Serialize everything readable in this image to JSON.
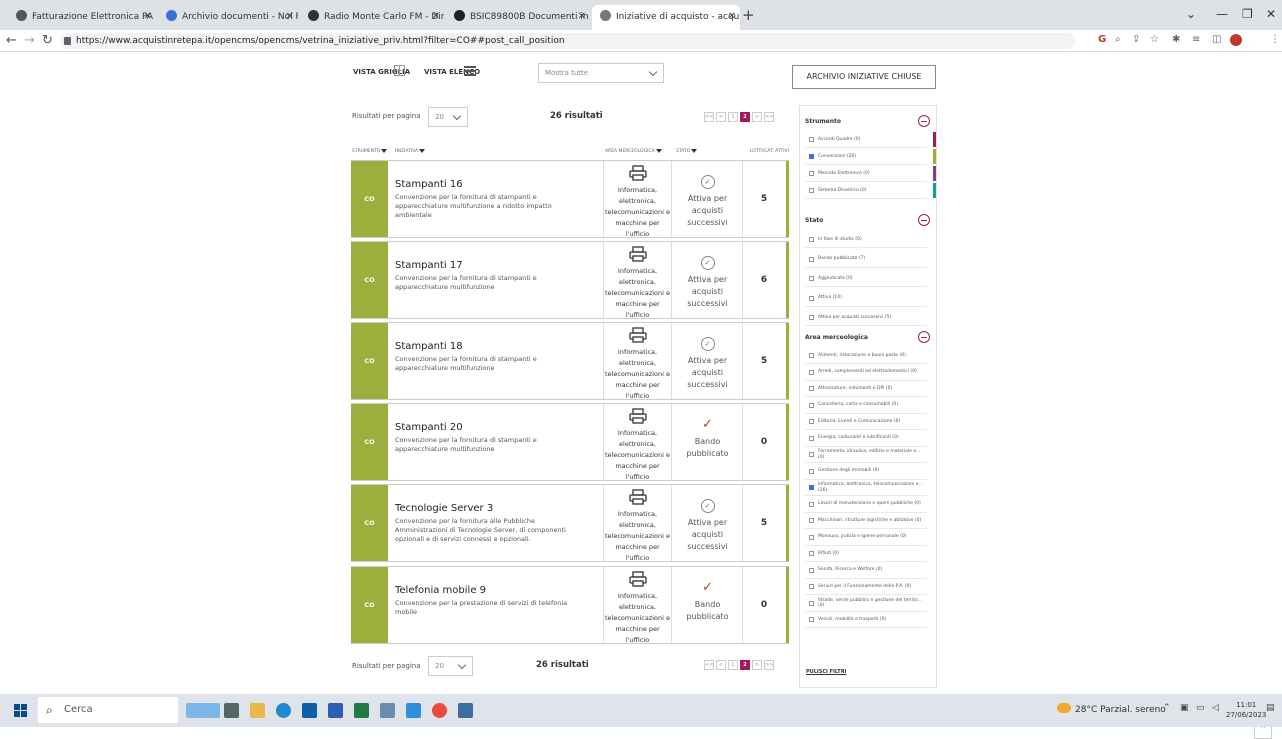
{
  "browser": {
    "tabs": [
      {
        "label": "Fatturazione Elettronica PA | Esiti"
      },
      {
        "label": "Archivio documenti - Noi PA"
      },
      {
        "label": "Radio Monte Carlo FM - Dire"
      },
      {
        "label": "BSIC89800B Documenti in DA Sl"
      },
      {
        "label": "Iniziative di acquisto - acquistinr"
      }
    ],
    "new_tab": "+",
    "url": "https://www.acquistinretepa.it/opencms/opencms/vetrina_iniziative_priv.html?filter=CO##post_call_position"
  },
  "toolbar": {
    "grid_label": "VISTA GRIGLIA",
    "list_label": "VISTA ELENCO",
    "show_select": "Mostra tutte",
    "archive_button": "ARCHIVIO INIZIATIVE CHIUSE"
  },
  "results": {
    "per_page_label": "Risultati per pagina",
    "per_page_value": "20",
    "count_text": "26 risultati",
    "pages": [
      "<<",
      "<",
      "1",
      "2",
      ">",
      ">>"
    ],
    "current_page": "2"
  },
  "columns": {
    "strumento": "STRUMENTO",
    "iniziativa": "INIZIATIVA",
    "area": "AREA MERCEOLOGICA",
    "stato": "STATO",
    "lotti": "LOTTI/CAT. ATTIVI"
  },
  "cards": [
    {
      "badge": "CO",
      "name": "Stampanti 16",
      "desc": "Convenzione per la fornitura di stampanti e apparecchiature multifunzione a ridotto impatto ambientale",
      "area": "Informatica, elettronica, telecomunicazioni e macchine per l'ufficio",
      "stato": "Attiva per acquisti successivi",
      "stato_icon": "clock",
      "lotti": "5"
    },
    {
      "badge": "CO",
      "name": "Stampanti 17",
      "desc": "Convenzione per la fornitura di stampanti e apparecchiature multifunzione",
      "area": "Informatica, elettronica, telecomunicazioni e macchine per l'ufficio",
      "stato": "Attiva per acquisti successivi",
      "stato_icon": "clock",
      "lotti": "6"
    },
    {
      "badge": "CO",
      "name": "Stampanti 18",
      "desc": "Convenzione per la fornitura di stampanti e apparecchiature multifunzione",
      "area": "Informatica, elettronica, telecomunicazioni e macchine per l'ufficio",
      "stato": "Attiva per acquisti successivi",
      "stato_icon": "clock",
      "lotti": "5"
    },
    {
      "badge": "CO",
      "name": "Stampanti 20",
      "desc": "Convenzione per la fornitura di stampanti e apparecchiature multifunzione",
      "area": "Informatica, elettronica, telecomunicazioni e macchine per l'ufficio",
      "stato": "Bando pubblicato",
      "stato_icon": "check",
      "lotti": "0"
    },
    {
      "badge": "CO",
      "name": "Tecnologie Server 3",
      "desc": "Convenzione per la fornitura alle Pubbliche Amministrazioni di Tecnologie Server, di componenti opzionali e di servizi connessi e opzionali.",
      "area": "Informatica, elettronica, telecomunicazioni e macchine per l'ufficio",
      "stato": "Attiva per acquisti successivi",
      "stato_icon": "clock",
      "lotti": "5"
    },
    {
      "badge": "CO",
      "name": "Telefonia mobile 9",
      "desc": "Convenzione per la prestazione di servizi di telefonia mobile",
      "area": "Informatica, elettronica, telecomunicazioni e macchine per l'ufficio",
      "stato": "Bando pubblicato",
      "stato_icon": "check",
      "lotti": "0"
    }
  ],
  "filters": {
    "strumento": {
      "title": "Strumento",
      "items": [
        {
          "label": "Accordi Quadro (0)",
          "checked": false,
          "color": "#a0195a"
        },
        {
          "label": "Convenzioni (26)",
          "checked": true,
          "color": "#9cae3c"
        },
        {
          "label": "Mercato Elettronico (0)",
          "checked": false,
          "color": "#7b3f8c"
        },
        {
          "label": "Sistema Dinamico (0)",
          "checked": false,
          "color": "#1a9a9a"
        }
      ]
    },
    "stato": {
      "title": "Stato",
      "items": [
        {
          "label": "In fase di studio (0)",
          "checked": false
        },
        {
          "label": "Bando pubblicato (7)",
          "checked": false
        },
        {
          "label": "Aggiudicata (0)",
          "checked": false
        },
        {
          "label": "Attiva (14)",
          "checked": false
        },
        {
          "label": "Attiva per acquisti successivi (5)",
          "checked": false
        }
      ]
    },
    "area": {
      "title": "Area merceologica",
      "items": [
        {
          "label": "Alimenti, ristorazione e buoni pasto (0)",
          "checked": false
        },
        {
          "label": "Arredi, complementi ed elettrodomestici (0)",
          "checked": false
        },
        {
          "label": "Attrezzature, indumenti e DPI (0)",
          "checked": false
        },
        {
          "label": "Cancelleria, carta e consumabili (0)",
          "checked": false
        },
        {
          "label": "Editoria, Eventi e Comunicazione (0)",
          "checked": false
        },
        {
          "label": "Energia, carburanti e lubrificanti (0)",
          "checked": false
        },
        {
          "label": "Ferramenta, idraulica, edilizia e materiale e... (0)",
          "checked": false
        },
        {
          "label": "Gestione degli Immobili (0)",
          "checked": false
        },
        {
          "label": "Informatica, elettronica, telecomunicazioni e... (26)",
          "checked": true
        },
        {
          "label": "Lavori di manutenzione e opere pubbliche (0)",
          "checked": false
        },
        {
          "label": "Macchinari, strutture logistiche e abitative (0)",
          "checked": false
        },
        {
          "label": "Monouso, pulizia e igiene personale (0)",
          "checked": false
        },
        {
          "label": "Rifiuti (0)",
          "checked": false
        },
        {
          "label": "Sanità, Ricerca e Welfare (0)",
          "checked": false
        },
        {
          "label": "Servizi per il Funzionamento della P.A. (0)",
          "checked": false
        },
        {
          "label": "Strade, verde pubblico e gestione del territo... (0)",
          "checked": false
        },
        {
          "label": "Veicoli, mobilità e trasporti (0)",
          "checked": false
        }
      ]
    },
    "clear_label": "PULISCI FILTRI"
  },
  "taskbar": {
    "search_placeholder": "Cerca",
    "weather": "28°C  Parzial. sereno",
    "time": "11:01",
    "date": "27/06/2023"
  },
  "colors": {
    "accent": "#a0195a",
    "convenzioni_green": "#9cae3c"
  }
}
